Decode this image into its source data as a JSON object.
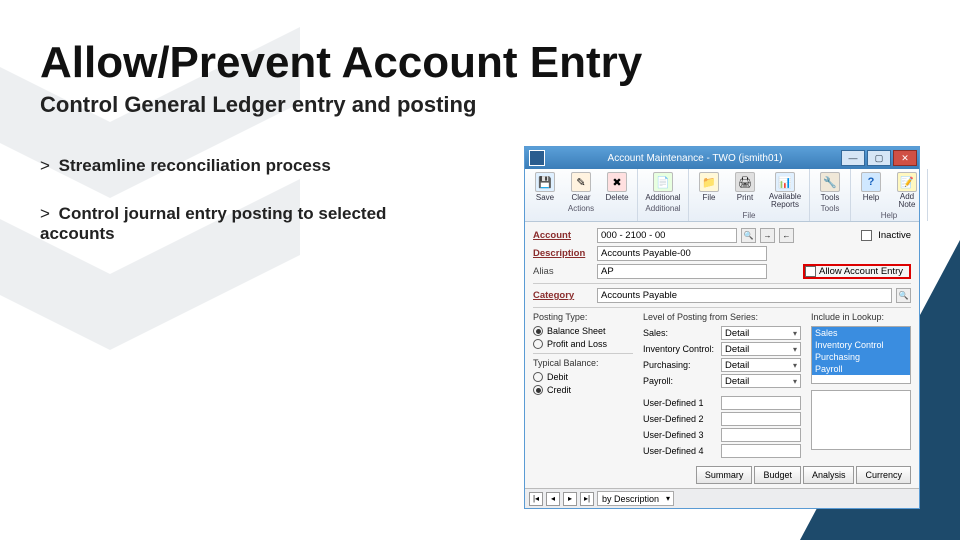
{
  "slide": {
    "title": "Allow/Prevent Account Entry",
    "subtitle": "Control General Ledger entry and posting",
    "bullets": [
      "Streamline reconciliation process",
      "Control journal entry posting to selected accounts"
    ]
  },
  "window": {
    "title": "Account Maintenance  -  TWO (jsmith01)",
    "buttons": {
      "min": "—",
      "max": "▢",
      "close": "✕"
    },
    "ribbon": {
      "actions_group": "Actions",
      "additional_group": "Additional",
      "file_group": "File",
      "tools_group": "Tools",
      "help_group": "Help",
      "items": {
        "save": "Save",
        "clear": "Clear",
        "delete": "Delete",
        "additional": "Additional",
        "file": "File",
        "print": "Print",
        "reports": "Available Reports",
        "tools": "Tools",
        "help": "Help",
        "note": "Add Note"
      }
    },
    "form": {
      "account_label": "Account",
      "account_value": "000 - 2100 - 00",
      "inactive_label": "Inactive",
      "description_label": "Description",
      "description_value": "Accounts Payable-00",
      "alias_label": "Alias",
      "alias_value": "AP",
      "allow_entry_label": "Allow Account Entry",
      "category_label": "Category",
      "category_value": "Accounts Payable",
      "posting_type": {
        "header": "Posting Type:",
        "balance": "Balance Sheet",
        "pl": "Profit and Loss"
      },
      "typical_balance": {
        "header": "Typical Balance:",
        "debit": "Debit",
        "credit": "Credit"
      },
      "level_header": "Level of Posting from Series:",
      "series": [
        {
          "label": "Sales:",
          "value": "Detail"
        },
        {
          "label": "Inventory Control:",
          "value": "Detail"
        },
        {
          "label": "Purchasing:",
          "value": "Detail"
        },
        {
          "label": "Payroll:",
          "value": "Detail"
        }
      ],
      "user_defined": [
        "User-Defined 1",
        "User-Defined 2",
        "User-Defined 3",
        "User-Defined 4"
      ],
      "lookup_header": "Include in Lookup:",
      "lookup_items": [
        "Sales",
        "Inventory Control",
        "Purchasing",
        "Payroll"
      ],
      "bottom_buttons": [
        "Summary",
        "Budget",
        "Analysis",
        "Currency"
      ],
      "nav": {
        "first": "|◂",
        "prev": "◂",
        "next": "▸",
        "last": "▸|",
        "sort": "by Description"
      }
    }
  }
}
